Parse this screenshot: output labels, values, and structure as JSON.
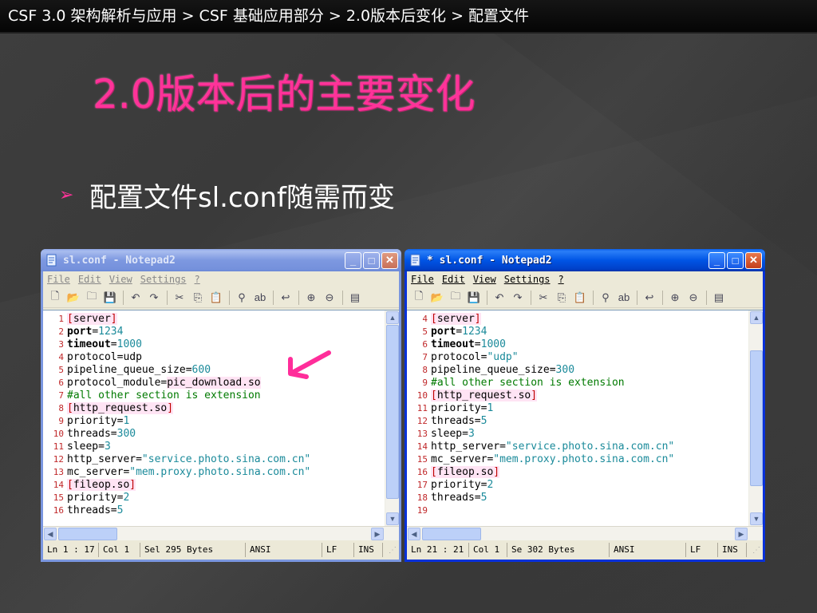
{
  "breadcrumb": {
    "text": "CSF 3.0 架构解析与应用 > CSF 基础应用部分 > 2.0版本后变化 > 配置文件"
  },
  "slide": {
    "title": "2.0版本后的主要变化",
    "bullet_icon": "arrow-bullet-icon",
    "bullet_text": "配置文件sl.conf随需而变"
  },
  "colors": {
    "title_accent": "#ff3399",
    "breadcrumb_bg": "#0a0a0a",
    "xp_title_active": "#0055e5",
    "xp_title_inactive": "#7d98e0",
    "line_number": "#c0282a",
    "section_bg": "#ffe4f4"
  },
  "windows": [
    {
      "title": "sl.conf - Notepad2",
      "active": false,
      "menu": [
        "File",
        "Edit",
        "View",
        "Settings",
        "?"
      ],
      "scroll_position": 0.0,
      "lines": [
        {
          "n": "1",
          "segments": [
            {
              "t": "[server]",
              "s": "section"
            }
          ]
        },
        {
          "n": "2",
          "segments": [
            {
              "t": "port",
              "s": "bold"
            },
            {
              "t": "=",
              "s": ""
            },
            {
              "t": "1234",
              "s": "num"
            }
          ]
        },
        {
          "n": "3",
          "segments": [
            {
              "t": "timeout",
              "s": "bold"
            },
            {
              "t": "=",
              "s": ""
            },
            {
              "t": "1000",
              "s": "num"
            }
          ]
        },
        {
          "n": "4",
          "segments": [
            {
              "t": "protocol=udp",
              "s": ""
            }
          ]
        },
        {
          "n": "5",
          "segments": [
            {
              "t": "pipeline_queue_size=",
              "s": ""
            },
            {
              "t": "600",
              "s": "num"
            }
          ]
        },
        {
          "n": "6",
          "segments": [
            {
              "t": "protocol_module=",
              "s": ""
            },
            {
              "t": "pic_download.so",
              "s": "hl"
            }
          ]
        },
        {
          "n": "7",
          "segments": [
            {
              "t": "#all other section is extension",
              "s": "comment"
            }
          ]
        },
        {
          "n": "8",
          "segments": [
            {
              "t": "[http_request.so]",
              "s": "section"
            }
          ]
        },
        {
          "n": "9",
          "segments": [
            {
              "t": "priority=",
              "s": ""
            },
            {
              "t": "1",
              "s": "num"
            }
          ]
        },
        {
          "n": "10",
          "segments": [
            {
              "t": "threads=",
              "s": ""
            },
            {
              "t": "300",
              "s": "num"
            }
          ]
        },
        {
          "n": "11",
          "segments": [
            {
              "t": "sleep=",
              "s": ""
            },
            {
              "t": "3",
              "s": "num"
            }
          ]
        },
        {
          "n": "12",
          "segments": [
            {
              "t": "http_server=",
              "s": ""
            },
            {
              "t": "\"service.photo.sina.com.cn\"",
              "s": "str"
            }
          ]
        },
        {
          "n": "13",
          "segments": [
            {
              "t": "mc_server=",
              "s": ""
            },
            {
              "t": "\"mem.proxy.photo.sina.com.cn\"",
              "s": "str"
            }
          ]
        },
        {
          "n": "14",
          "segments": [
            {
              "t": "[fileop.so]",
              "s": "section"
            }
          ]
        },
        {
          "n": "15",
          "segments": [
            {
              "t": "priority=",
              "s": ""
            },
            {
              "t": "2",
              "s": "num"
            }
          ]
        },
        {
          "n": "16",
          "segments": [
            {
              "t": "threads=",
              "s": ""
            },
            {
              "t": "5",
              "s": "num"
            }
          ]
        }
      ],
      "status": {
        "ln": "Ln 1 : 17",
        "col": "Col 1",
        "sel": "Sel 295 Bytes",
        "enc": "ANSI",
        "eol": "LF",
        "ins": "INS"
      }
    },
    {
      "title": "* sl.conf - Notepad2",
      "active": true,
      "menu": [
        "File",
        "Edit",
        "View",
        "Settings",
        "?"
      ],
      "scroll_position": 0.2,
      "lines": [
        {
          "n": "4",
          "segments": [
            {
              "t": "[server]",
              "s": "section"
            }
          ]
        },
        {
          "n": "5",
          "segments": [
            {
              "t": "port",
              "s": "bold"
            },
            {
              "t": "=",
              "s": ""
            },
            {
              "t": "1234",
              "s": "num"
            }
          ]
        },
        {
          "n": "6",
          "segments": [
            {
              "t": "timeout",
              "s": "bold"
            },
            {
              "t": "=",
              "s": ""
            },
            {
              "t": "1000",
              "s": "num"
            }
          ]
        },
        {
          "n": "7",
          "segments": [
            {
              "t": "protocol=",
              "s": ""
            },
            {
              "t": "\"udp\"",
              "s": "str"
            }
          ]
        },
        {
          "n": "8",
          "segments": [
            {
              "t": "pipeline_queue_size=",
              "s": ""
            },
            {
              "t": "300",
              "s": "num"
            }
          ]
        },
        {
          "n": "9",
          "segments": [
            {
              "t": "#all other section is extension",
              "s": "comment"
            }
          ]
        },
        {
          "n": "10",
          "segments": [
            {
              "t": "[http_request.so]",
              "s": "section"
            }
          ]
        },
        {
          "n": "11",
          "segments": [
            {
              "t": "priority=",
              "s": ""
            },
            {
              "t": "1",
              "s": "num"
            }
          ]
        },
        {
          "n": "12",
          "segments": [
            {
              "t": "threads=",
              "s": ""
            },
            {
              "t": "5",
              "s": "num"
            }
          ]
        },
        {
          "n": "13",
          "segments": [
            {
              "t": "sleep=",
              "s": ""
            },
            {
              "t": "3",
              "s": "num"
            }
          ]
        },
        {
          "n": "14",
          "segments": [
            {
              "t": "http_server=",
              "s": ""
            },
            {
              "t": "\"service.photo.sina.com.cn\"",
              "s": "str"
            }
          ]
        },
        {
          "n": "15",
          "segments": [
            {
              "t": "mc_server=",
              "s": ""
            },
            {
              "t": "\"mem.proxy.photo.sina.com.cn\"",
              "s": "str"
            }
          ]
        },
        {
          "n": "16",
          "segments": [
            {
              "t": "[fileop.so]",
              "s": "section"
            }
          ]
        },
        {
          "n": "17",
          "segments": [
            {
              "t": "priority=",
              "s": ""
            },
            {
              "t": "2",
              "s": "num"
            }
          ]
        },
        {
          "n": "18",
          "segments": [
            {
              "t": "threads=",
              "s": ""
            },
            {
              "t": "5",
              "s": "num"
            }
          ]
        },
        {
          "n": "19",
          "segments": []
        }
      ],
      "status": {
        "ln": "Ln 21 : 21",
        "col": "Col 1",
        "sel": "Se 302 Bytes",
        "enc": "ANSI",
        "eol": "LF",
        "ins": "INS"
      }
    }
  ],
  "toolbar_icons": [
    "new-icon",
    "open-icon",
    "browse-icon",
    "save-icon",
    "undo-icon",
    "redo-icon",
    "cut-icon",
    "copy-icon",
    "paste-icon",
    "find-icon",
    "replace-icon",
    "wordwrap-icon",
    "zoom-in-icon",
    "zoom-out-icon",
    "view-icon"
  ],
  "annotation_icon": "pink-arrow-icon"
}
